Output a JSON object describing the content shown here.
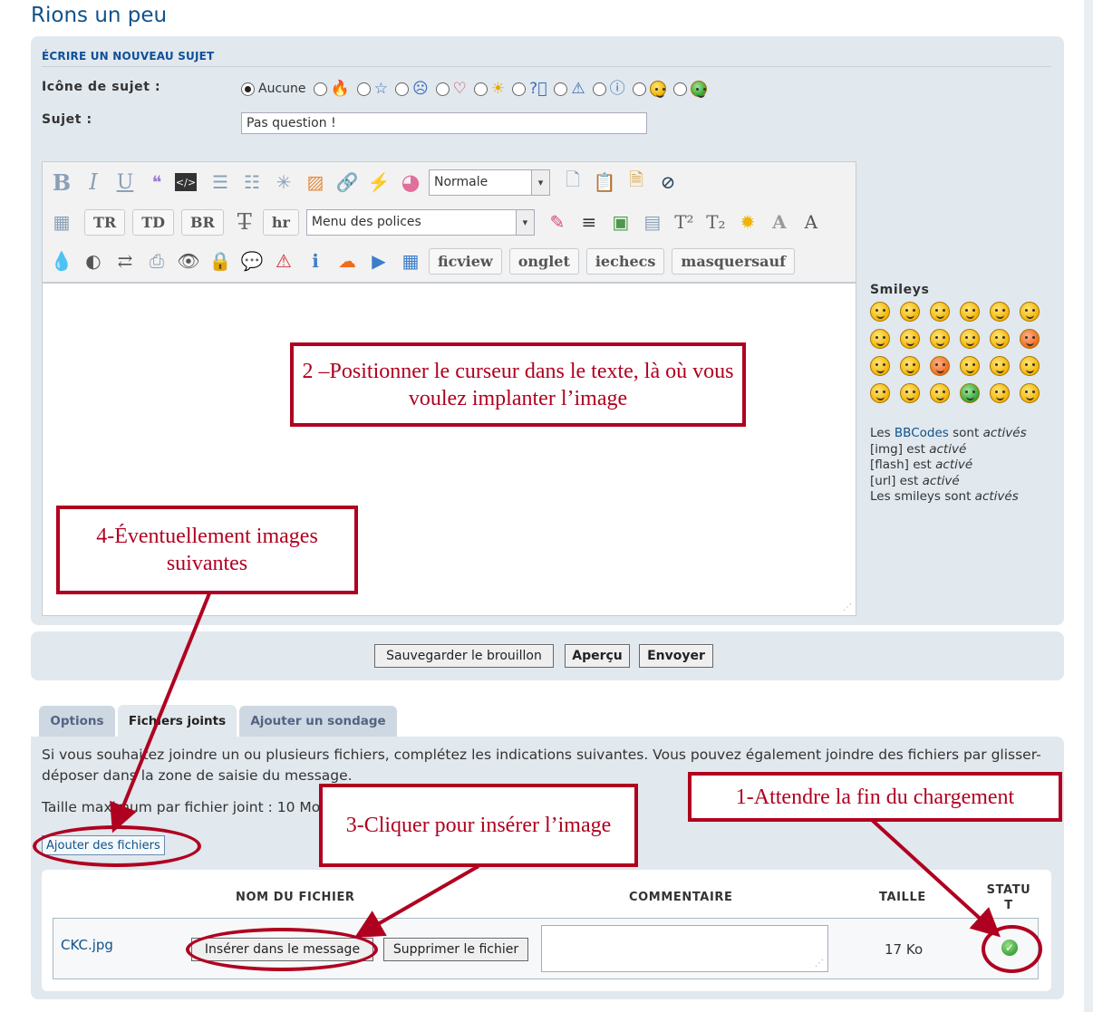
{
  "page": {
    "title": "Rions un peu"
  },
  "post": {
    "heading": "ÉCRIRE UN NOUVEAU SUJET",
    "icon_label": "Icône de sujet :",
    "icon_none": "Aucune",
    "topic_icons": [
      "fire",
      "star",
      "surprised",
      "heart",
      "sun",
      "question",
      "warning",
      "info",
      "wink",
      "grin"
    ],
    "subject_label": "Sujet :",
    "subject_value": "Pas question !"
  },
  "toolbar": {
    "row1": [
      "B",
      "I",
      "U",
      "quote",
      "code",
      "list",
      "list-numbered",
      "asterisk",
      "image",
      "link",
      "flash",
      "color"
    ],
    "font_size_selected": "Normale",
    "row2_text_buttons": [
      "TR",
      "TD",
      "BR",
      "hr"
    ],
    "font_menu_selected": "Menu des polices",
    "row3_text_buttons": [
      "ficview",
      "onglet",
      "iechecs",
      "masquersauf"
    ]
  },
  "sidebar": {
    "smileys_title": "Smileys",
    "bbcode_prefix": "Les",
    "bbcode_link": "BBCodes",
    "bbcode_suffix": "sont",
    "activated": "activés",
    "img_line": "[img] est",
    "flash_line": "[flash] est",
    "url_line": "[url] est",
    "active": "activé",
    "smileys_line": "Les smileys sont"
  },
  "submit": {
    "save_draft": "Sauvegarder le brouillon",
    "preview": "Aperçu",
    "send": "Envoyer"
  },
  "tabs": [
    "Options",
    "Fichiers joints",
    "Ajouter un sondage"
  ],
  "attachments": {
    "intro": "Si vous souhaitez joindre un ou plusieurs fichiers, complétez les indications suivantes. Vous pouvez également joindre des fichiers par glisser-déposer dans la zone de saisie du message.",
    "max_size": "Taille maximum par fichier joint : 10 Mo.",
    "add_files": "Ajouter des fichiers",
    "col_name": "NOM DU FICHIER",
    "col_comment": "COMMENTAIRE",
    "col_size": "TAILLE",
    "col_status": "STATUT",
    "file": {
      "name": "CKC.jpg",
      "insert": "Insérer dans le message",
      "delete": "Supprimer le fichier",
      "size": "17 Ko",
      "status": "ok"
    }
  },
  "callouts": {
    "step1": "1-Attendre la fin du chargement",
    "step2": "2 –Positionner le curseur dans le texte, là où vous voulez implanter l’image",
    "step3": "3-Cliquer pour insérer l’image",
    "step4": "4-Éventuellement images suivantes"
  },
  "colors": {
    "annotation": "#b00020",
    "panel": "#e1e8ee",
    "link": "#105289"
  }
}
